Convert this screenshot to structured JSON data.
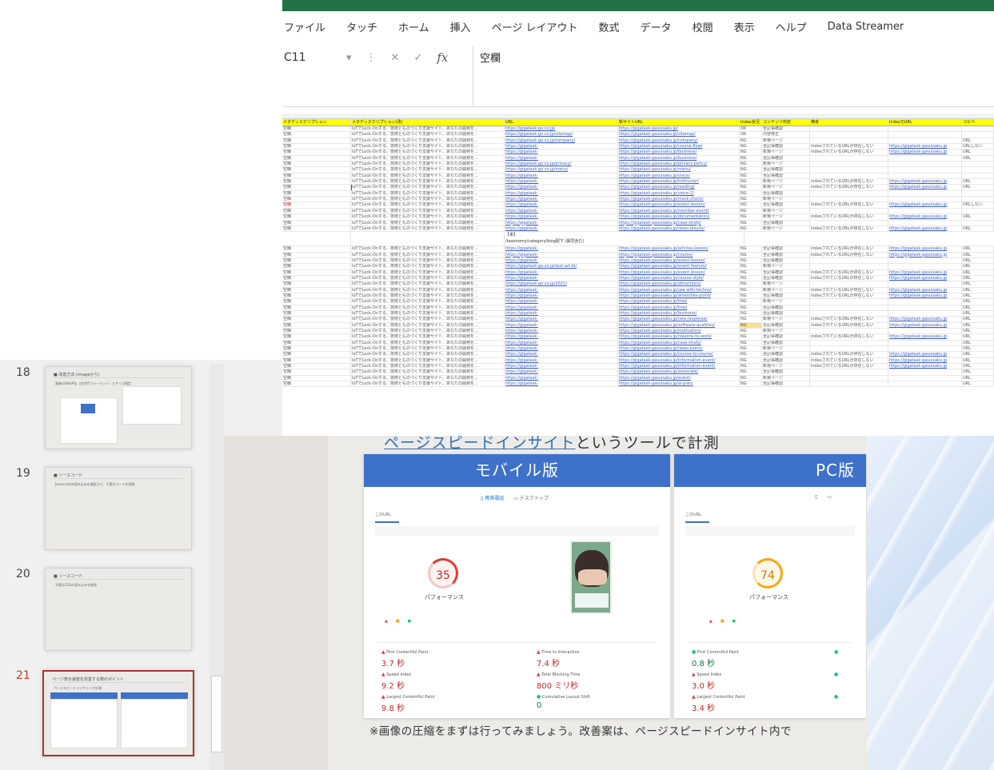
{
  "excel": {
    "ribbon_tabs": [
      "ファイル",
      "タッチ",
      "ホーム",
      "挿入",
      "ページ レイアウト",
      "数式",
      "データ",
      "校閲",
      "表示",
      "ヘルプ",
      "Data Streamer"
    ],
    "name_box": "C11",
    "formula_value": "空欄",
    "header": [
      "メタディスクリプション",
      "メタディスクリプション(改)",
      "URL",
      "新サイトURL",
      "Index状況",
      "コンテンツ判定",
      "備考",
      "Index元URL",
      "コピペ"
    ],
    "rows": [
      {
        "a": "空欄",
        "b": "IoTでLock-Onする、技術とものづくり支援サイト、あなたの開発を...",
        "c": "https://gigatask-go.co.jp/",
        "d": "https://gigatask-gasuisaku.jp/",
        "e": "OK",
        "f": "全記事確認",
        "g": "",
        "h": "",
        "i": "",
        "red": false
      },
      {
        "a": "空欄",
        "b": "IoTでLock-Onする、技術とものづくり支援サイト、あなたの開発を...",
        "c": "https://gigatask-go.co.jp/sitemap/",
        "d": "https://gigatask-gasuisaku.jp/sitemap/",
        "e": "OK",
        "f": "内容修正",
        "g": "",
        "h": "",
        "i": "",
        "red": false
      },
      {
        "a": "空欄",
        "b": "IoTでLock-Onする、技術とものづくり支援サイト、あなたの開発を...",
        "c": "https://gigatask-go.co.jp/company/",
        "d": "https://gigatask-gasuisaku.jp/company/",
        "e": "NG",
        "f": "新規ページ",
        "g": "",
        "h": "",
        "i": "URL",
        "red": false
      },
      {
        "a": "空欄",
        "b": "IoTでLock-Onする、技術とものづくり支援サイト、あなたの開発を...",
        "c": "https://gigatask-",
        "d": "https://gigatask-gasuisaku.jp/course-flow/",
        "e": "NG",
        "f": "全記事確認",
        "g": "indexされているURLが存在しない",
        "h": "https://gigatask-gasuisaku.jp",
        "i": "URLしない",
        "red": false
      },
      {
        "a": "空欄",
        "b": "IoTでLock-Onする、技術とものづくり支援サイト、あなたの開発を...",
        "c": "https://gigatask-",
        "d": "https://gigatask-gasuisaku.jp/business/",
        "e": "NG",
        "f": "新規ページ",
        "g": "indexされているURLが存在しない",
        "h": "https://gigatask-gasuisaku.jp",
        "i": "URL",
        "red": false
      },
      {
        "a": "空欄",
        "b": "IoTでLock-Onする、技術とものづくり支援サイト、あなたの開発を...",
        "c": "https://gigatask-",
        "d": "https://gigatask-gasuisaku.jp/business/",
        "e": "NG",
        "f": "全記事確認",
        "g": "",
        "h": "",
        "i": "URL",
        "red": false
      },
      {
        "a": "空欄",
        "b": "IoTでLock-Onする、技術とものづくり支援サイト、あなたの開発を...",
        "c": "https://gigatask-go.co.jp/privacy/",
        "d": "https://gigatask-gasuisaku.jp/privacy-policy/",
        "e": "NG",
        "f": "新規ページ",
        "g": "",
        "h": "",
        "i": "",
        "red": false
      },
      {
        "a": "空欄",
        "b": "IoTでLock-Onする、技術とものづくり支援サイト、あなたの開発を...",
        "c": "https://gigatask-go.co.jp/menu/",
        "d": "https://gigatask-gasuisaku.jp/menu/",
        "e": "NG",
        "f": "全記事確認",
        "g": "",
        "h": "",
        "i": "",
        "red": false
      },
      {
        "a": "空欄",
        "b": "IoTでLock-Onする、技術とものづくり支援サイト、あなたの開発を...",
        "c": "https://gigatask-",
        "d": "https://gigatask-gasuisaku.jp/voice/",
        "e": "NG",
        "f": "全記事確認",
        "g": "",
        "h": "",
        "i": "",
        "red": false
      },
      {
        "a": "空欄",
        "b": "IoTでLock-Onする、技術とものづくり支援サイト、あなたの開発を...",
        "c": "https://gigatask-",
        "d": "https://gigatask-gasuisaku.jp/instructor/",
        "e": "NG",
        "f": "新規ページ",
        "g": "indexされているURLが存在しない",
        "h": "https://gigatask-gasuisaku.jp",
        "i": "URL",
        "red": false
      },
      {
        "a": "空欄",
        "b": "IoTでLock-Onする、技術とものづくり支援サイト、あなたの開発を...",
        "c": "https://gigatask-",
        "d": "https://gigatask-gasuisaku.jp/reading/",
        "e": "NG",
        "f": "新規ページ",
        "g": "indexされているURLが存在しない",
        "h": "https://gigatask-gasuisaku.jp",
        "i": "URL",
        "red": false
      },
      {
        "a": "空欄",
        "b": "IoTでLock-Onする、技術とものづくり支援サイト、あなたの開発を...",
        "c": "https://gigatask-",
        "d": "https://gigatask-gasuisaku.jp/voice-2/",
        "e": "NG",
        "f": "全記事確認",
        "g": "",
        "h": "",
        "i": "",
        "red": false
      },
      {
        "a": "空欄",
        "b": "IoTでLock-Onする、技術とものづくり支援サイト、あなたの開発を...",
        "c": "https://gigatask-",
        "d": "https://gigatask-gasuisaku.jp/mock-check/",
        "e": "NG",
        "f": "新規ページ",
        "g": "",
        "h": "",
        "i": "",
        "red": false
      },
      {
        "a": "空欄",
        "b": "IoTでLock-Onする、技術とものづくり支援サイト、あなたの開発を...",
        "c": "https://gigatask-",
        "d": "https://gigatask-gasuisaku.jp/event-lesson/",
        "e": "NG",
        "f": "全記事確認",
        "g": "indexされているURLが存在しない",
        "h": "https://gigatask-gasuisaku.jp",
        "i": "URLしない",
        "red": true
      },
      {
        "a": "空欄",
        "b": "IoTでLock-Onする、技術とものづくり支援サイト、あなたの開発を...",
        "c": "https://gigatask-",
        "d": "https://gigatask-gasuisaku.jp/member-event/",
        "e": "NG",
        "f": "新規ページ",
        "g": "",
        "h": "",
        "i": "",
        "red": false
      },
      {
        "a": "空欄",
        "b": "IoTでLock-Onする、技術とものづくり支援サイト、あなたの開発を...",
        "c": "https://gigatask-",
        "d": "https://gigatask-gasuisaku.jp/documentation/",
        "e": "NG",
        "f": "新規ページ",
        "g": "indexされているURLが存在しない",
        "h": "https://gigatask-gasuisaku.jp",
        "i": "URL",
        "red": false
      },
      {
        "a": "空欄",
        "b": "IoTでLock-Onする、技術とものづくり支援サイト、あなたの開発を...",
        "c": "https://gigatask-",
        "d": "https://gigatask-gasuisaku.jp/case-study/",
        "e": "NG",
        "f": "全記事確認",
        "g": "",
        "h": "",
        "i": "",
        "red": false
      },
      {
        "a": "空欄",
        "b": "IoTでLock-Onする、技術とものづくり支援サイト、あなたの開発を...",
        "c": "https://gigatask-",
        "d": "https://gigatask-gasuisaku.jp/news-results/",
        "e": "NG",
        "f": "新規ページ",
        "g": "indexされているURLが存在しない",
        "h": "https://gigatask-gasuisaku.jp",
        "i": "URL",
        "red": false
      }
    ],
    "note_line1": "【未】",
    "note_line2": "/taxonomy/category/blog配下 (異同含む)",
    "rows2": [
      {
        "a": "空欄",
        "b": "IoTでLock-Onする、技術とものづくり支援サイト、あなたの開発を...",
        "c": "https://gigatask-",
        "d": "https://gigatask-gasuisaku.jp/articles-lesson/",
        "e": "NG",
        "f": "全記事確認",
        "g": "indexされているURLが存在しない",
        "h": "https://gigatask-gasuisaku.jp",
        "i": "URL",
        "red": false
      },
      {
        "a": "空欄",
        "b": "IoTでLock-Onする、技術とものづくり支援サイト、あなたの開発を...",
        "c": "https://gigatask-",
        "d": "https://gigatask-gasuisaku.jp/course/",
        "e": "NG",
        "f": "全記事確認",
        "g": "indexされているURLが存在しない",
        "h": "https://gigatask-gasuisaku.jp",
        "i": "URL",
        "red": false
      },
      {
        "a": "空欄",
        "b": "IoTでLock-Onする、技術とものづくり支援サイト、あなたの開発を...",
        "c": "https://gigatask-",
        "d": "https://gigatask-gasuisaku.jp/event-lesson/",
        "e": "NG",
        "f": "全記事確認",
        "g": "",
        "h": "",
        "i": "URL",
        "red": false
      },
      {
        "a": "空欄",
        "b": "IoTでLock-Onする、技術とものづくり支援サイト、あなたの開発を...",
        "c": "https://gigatask-go.co.jp/text-art-bl/",
        "d": "https://gigatask-gasuisaku.jp/event-feature/",
        "e": "NG",
        "f": "新規ページ",
        "g": "",
        "h": "",
        "i": "URL",
        "red": false
      },
      {
        "a": "空欄",
        "b": "IoTでLock-Onする、技術とものづくり支援サイト、あなたの開発を...",
        "c": "https://gigatask-",
        "d": "https://gigatask-gasuisaku.jp/event-lesson/",
        "e": "NG",
        "f": "全記事確認",
        "g": "indexされているURLが存在しない",
        "h": "https://gigatask-gasuisaku.jp",
        "i": "URL",
        "red": false
      },
      {
        "a": "空欄",
        "b": "IoTでLock-Onする、技術とものづくり支援サイト、あなたの開発を...",
        "c": "https://gigatask-",
        "d": "https://gigatask-gasuisaku.jp/course-style/",
        "e": "NG",
        "f": "全記事確認",
        "g": "indexされているURLが存在しない",
        "h": "https://gigatask-gasuisaku.jp",
        "i": "URL",
        "red": false
      },
      {
        "a": "空欄",
        "b": "IoTでLock-Onする、技術とものづくり支援サイト、あなたの開発を...",
        "c": "https://gigatask-go.co.jp/2021/",
        "d": "https://gigatask-gasuisaku.jp/attractions/",
        "e": "NG",
        "f": "新規ページ",
        "g": "",
        "h": "",
        "i": "URL",
        "red": false
      },
      {
        "a": "空欄",
        "b": "IoTでLock-Onする、技術とものづくり支援サイト、あなたの開発を...",
        "c": "https://gigatask-",
        "d": "https://gigatask-gasuisaku.jp/use-with-techno/",
        "e": "NG",
        "f": "新規ページ",
        "g": "indexされているURLが存在しない",
        "h": "https://gigatask-gasuisaku.jp",
        "i": "URL",
        "red": false
      },
      {
        "a": "空欄",
        "b": "IoTでLock-Onする、技術とものづくり支援サイト、あなたの開発を...",
        "c": "https://gigatask-",
        "d": "https://gigatask-gasuisaku.jp/amenities-point/",
        "e": "NG",
        "f": "全記事確認",
        "g": "indexされているURLが存在しない",
        "h": "https://gigatask-gasuisaku.jp",
        "i": "URL",
        "red": false
      },
      {
        "a": "空欄",
        "b": "IoTでLock-Onする、技術とものづくり支援サイト、あなたの開発を...",
        "c": "https://gigatask-",
        "d": "https://gigatask-gasuisaku.jp/trial/",
        "e": "NG",
        "f": "新規ページ",
        "g": "",
        "h": "",
        "i": "URL",
        "red": false
      },
      {
        "a": "空欄",
        "b": "IoTでLock-Onする、技術とものづくり支援サイト、あなたの開発を...",
        "c": "https://gigatask-",
        "d": "https://gigatask-gasuisaku.jp/trial/",
        "e": "NG",
        "f": "全記事確認",
        "g": "",
        "h": "",
        "i": "URL",
        "red": false
      },
      {
        "a": "空欄",
        "b": "IoTでLock-Onする、技術とものづくり支援サイト、あなたの開発を...",
        "c": "https://gigatask-",
        "d": "https://gigatask-gasuisaku.jp/business/",
        "e": "NG",
        "f": "全記事確認",
        "g": "",
        "h": "",
        "i": "URL",
        "red": false
      },
      {
        "a": "空欄",
        "b": "IoTでLock-Onする、技術とものづくり支援サイト、あなたの開発を...",
        "c": "https://gigatask-",
        "d": "https://gigatask-gasuisaku.jp/new-response/",
        "e": "NG",
        "f": "新規ページ",
        "g": "indexされているURLが存在しない",
        "h": "https://gigatask-gasuisaku.jp",
        "i": "URL",
        "red": false
      },
      {
        "a": "空欄",
        "b": "IoTでLock-Onする、技術とものづくり支援サイト、あなたの開発を...",
        "c": "https://gigatask-",
        "d": "https://gigatask-gasuisaku.jp/software-qualities/",
        "e": "NG",
        "f": "全記事確認",
        "g": "indexされているURLが存在しない",
        "h": "https://gigatask-gasuisaku.jp",
        "i": "URL",
        "red": false,
        "hl": true
      },
      {
        "a": "空欄",
        "b": "IoTでLock-Onする、技術とものづくり支援サイト、あなたの開発を...",
        "c": "https://gigatask-",
        "d": "https://gigatask-gasuisaku.jp/motivation/",
        "e": "NG",
        "f": "新規ページ",
        "g": "",
        "h": "",
        "i": "URL",
        "red": false
      },
      {
        "a": "空欄",
        "b": "IoTでLock-Onする、技術とものづくり支援サイト、あなたの開発を...",
        "c": "https://gigatask-",
        "d": "https://gigatask-gasuisaku.jp/reasons-to-work/",
        "e": "NG",
        "f": "全記事確認",
        "g": "indexされているURLが存在しない",
        "h": "https://gigatask-gasuisaku.jp",
        "i": "URL",
        "red": false
      },
      {
        "a": "空欄",
        "b": "IoTでLock-Onする、技術とものづくり支援サイト、あなたの開発を...",
        "c": "https://gigatask-",
        "d": "https://gigatask-gasuisaku.jp/case-study/",
        "e": "NG",
        "f": "全記事確認",
        "g": "",
        "h": "",
        "i": "URL",
        "red": false
      },
      {
        "a": "空欄",
        "b": "IoTでLock-Onする、技術とものづくり支援サイト、あなたの開発を...",
        "c": "https://gigatask-",
        "d": "https://gigatask-gasuisaku.jp/news-event/",
        "e": "NG",
        "f": "新規ページ",
        "g": "",
        "h": "",
        "i": "URL",
        "red": false
      },
      {
        "a": "空欄",
        "b": "IoTでLock-Onする、技術とものづくり支援サイト、あなたの開発を...",
        "c": "https://gigatask-",
        "d": "https://gigatask-gasuisaku.jp/course-to-course/",
        "e": "NG",
        "f": "全記事確認",
        "g": "indexされているURLが存在しない",
        "h": "https://gigatask-gasuisaku.jp",
        "i": "URL",
        "red": false
      },
      {
        "a": "空欄",
        "b": "IoTでLock-Onする、技術とものづくり支援サイト、あなたの開発を...",
        "c": "https://gigatask-",
        "d": "https://gigatask-gasuisaku.jp/information-event/",
        "e": "NG",
        "f": "全記事確認",
        "g": "indexされているURLが存在しない",
        "h": "https://gigatask-gasuisaku.jp",
        "i": "URL",
        "red": false
      },
      {
        "a": "空欄",
        "b": "IoTでLock-Onする、技術とものづくり支援サイト、あなたの開発を...",
        "c": "https://gigatask-",
        "d": "https://gigatask-gasuisaku.jp/information-event/",
        "e": "NG",
        "f": "新規ページ",
        "g": "indexされているURLが存在しない",
        "h": "https://gigatask-gasuisaku.jp",
        "i": "URL",
        "red": false
      },
      {
        "a": "空欄",
        "b": "IoTでLock-Onする、技術とものづくり支援サイト、あなたの開発を...",
        "c": "https://gigatask-",
        "d": "https://gigatask-gasuisaku.jp/associate/",
        "e": "NG",
        "f": "全記事確認",
        "g": "",
        "h": "",
        "i": "URL",
        "red": false
      },
      {
        "a": "空欄",
        "b": "IoTでLock-Onする、技術とものづくり支援サイト、あなたの開発を...",
        "c": "https://gigatask-",
        "d": "https://gigatask-gasuisaku.jp/event/",
        "e": "NG",
        "f": "新規ページ",
        "g": "",
        "h": "",
        "i": "URL",
        "red": false
      },
      {
        "a": "空欄",
        "b": "IoTでLock-Onする、技術とものづくり支援サイト、あなたの開発を...",
        "c": "https://gigatask-",
        "d": "https://gigatask-gasuisaku.jp/ai-plan/",
        "e": "NG",
        "f": "全記事確認",
        "g": "",
        "h": "",
        "i": "URL",
        "red": false
      }
    ]
  },
  "thumbnails": [
    {
      "num": "18",
      "head": "■ 改善方法 (imageから)",
      "text": "画像のWebP化（次世代フォーマット）とサイズ指定"
    },
    {
      "num": "19",
      "head": "■ ソースコード",
      "text": "Javascriptの読み込みを遅延させ、不要なコードを削除"
    },
    {
      "num": "20",
      "head": "■ ソースコード",
      "text": "不要なCSSの読み込みを削除"
    },
    {
      "num": "21",
      "head": "ページ表示速度を改善する際のポイント",
      "text": "ページスピードインサイトで計測"
    }
  ],
  "slide": {
    "title_link": "ページスピードインサイト",
    "title_rest": "というツールで計測",
    "footer": "※画像の圧縮をまずは行ってみましょう。改善案は、ページスピードインサイト内で",
    "mobile": {
      "heading": "モバイル版",
      "tab_mobile": "携帯電話",
      "tab_desktop": "デスクトップ",
      "url_tab": "このURL",
      "score": "35",
      "perf_label": "パフォーマンス",
      "metrics": [
        {
          "label": "First Contentful Paint",
          "value": "3.7 秒",
          "status": "red"
        },
        {
          "label": "Time to Interactive",
          "value": "7.4 秒",
          "status": "red"
        },
        {
          "label": "Speed Index",
          "value": "9.2 秒",
          "status": "red"
        },
        {
          "label": "Total Blocking Time",
          "value": "800 ミリ秒",
          "status": "red"
        },
        {
          "label": "Largest Contentful Paint",
          "value": "9.8 秒",
          "status": "red"
        },
        {
          "label": "Cumulative Layout Shift",
          "value": "0",
          "status": "green"
        }
      ]
    },
    "pc": {
      "heading": "PC版",
      "url_tab": "このURL",
      "score": "74",
      "perf_label": "パフォーマンス",
      "metrics": [
        {
          "label": "First Contentful Paint",
          "value": "0.8 秒",
          "status": "green"
        },
        {
          "label": "Speed Index",
          "value": "3.0 秒",
          "status": "red"
        },
        {
          "label": "Largest Contentful Paint",
          "value": "3.4 秒",
          "status": "red"
        }
      ]
    }
  },
  "colors": {
    "excel_green": "#217346",
    "header_yellow": "#ffff00",
    "psi_blue": "#3e71c9",
    "active_red": "#a83232"
  }
}
